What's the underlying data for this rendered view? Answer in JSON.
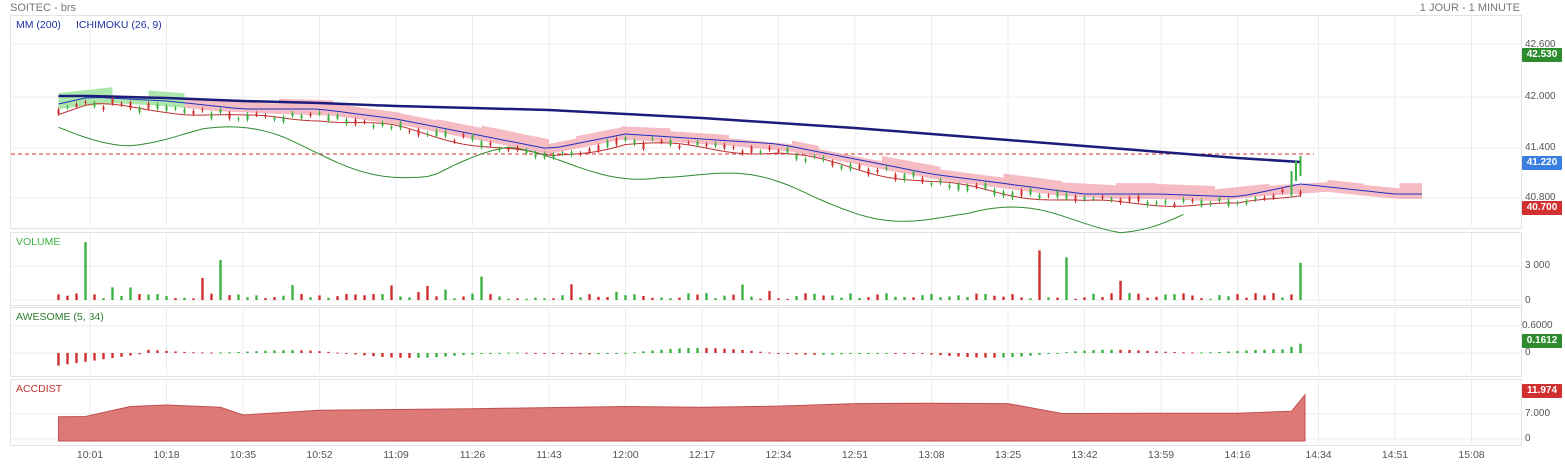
{
  "header": {
    "title": "SOITEC - brs",
    "period": "1 JOUR - 1 MINUTE"
  },
  "main_panel": {
    "legend_ma": "MM (200)",
    "legend_ichimoku": "ICHIMOKU (26, 9)",
    "y_ticks": [
      "42.600",
      "42.000",
      "41.400",
      "40.800"
    ],
    "tags": [
      {
        "text": "42.530",
        "color": "#2e8b2e"
      },
      {
        "text": "41.220",
        "color": "#3a7fe0"
      },
      {
        "text": "40.700",
        "color": "#d03030"
      }
    ]
  },
  "volume_panel": {
    "label": "VOLUME",
    "y_ticks": [
      "3 000",
      "0"
    ]
  },
  "awesome_panel": {
    "label": "AWESOME (5, 34)",
    "y_ticks": [
      "0.6000",
      "0"
    ],
    "tag": {
      "text": "0.1612",
      "color": "#2e8b2e"
    }
  },
  "accdist_panel": {
    "label": "ACCDIST",
    "y_ticks": [
      "7.000",
      "0"
    ],
    "tag": {
      "text": "11.974",
      "color": "#d03030"
    }
  },
  "x_labels": [
    "10:01",
    "10:18",
    "10:35",
    "10:52",
    "11:09",
    "11:26",
    "11:43",
    "12:00",
    "12:17",
    "12:34",
    "12:51",
    "13:08",
    "13:25",
    "13:42",
    "13:59",
    "14:16",
    "14:34",
    "14:51",
    "15:08"
  ],
  "colors": {
    "up": "#3cb043",
    "down": "#d03030",
    "ma": "#1c1c7a",
    "tenkan": "#c03030",
    "kijun": "#2030c0",
    "chikou": "#2e8b2e",
    "cloud_up": "#9fe39f",
    "cloud_down": "#f4b0b8",
    "accdist_fill": "#dd7a78"
  },
  "chart_data": [
    {
      "type": "line",
      "title": "SOITEC - brs",
      "subtitle": "1 JOUR - 1 MINUTE",
      "ylim": [
        40.6,
        42.7
      ],
      "x": [
        "09:54",
        "10:01",
        "10:18",
        "10:35",
        "10:52",
        "11:09",
        "11:26",
        "11:43",
        "12:00",
        "12:17",
        "12:34",
        "12:51",
        "13:08",
        "13:25",
        "13:42",
        "13:59",
        "14:16",
        "14:30",
        "14:51"
      ],
      "series": [
        {
          "name": "MM (200)",
          "values": [
            41.9,
            41.9,
            41.88,
            41.85,
            41.83,
            41.8,
            41.78,
            41.76,
            41.72,
            41.68,
            41.63,
            41.58,
            41.52,
            41.46,
            41.4,
            41.34,
            41.28,
            41.24,
            null
          ]
        },
        {
          "name": "ICHIMOKU (26, 9)",
          "values": [
            41.75,
            41.82,
            41.78,
            41.7,
            41.7,
            41.6,
            41.45,
            41.3,
            41.45,
            41.4,
            41.35,
            41.2,
            41.05,
            40.95,
            40.85,
            40.85,
            40.82,
            40.95,
            40.85
          ]
        }
      ],
      "last_price": 41.22,
      "high_tag": 42.53,
      "low_tag": 40.7,
      "reference_line": 41.32
    },
    {
      "type": "bar",
      "title": "VOLUME",
      "ylim": [
        0,
        4500
      ],
      "note_seed": 7,
      "spikes": [
        {
          "x": "10:00",
          "value": 4200,
          "dir": "up"
        },
        {
          "x": "10:27",
          "value": 1600,
          "dir": "down"
        },
        {
          "x": "10:30",
          "value": 2900,
          "dir": "up"
        },
        {
          "x": "11:29",
          "value": 1700,
          "dir": "up"
        },
        {
          "x": "13:32",
          "value": 3600,
          "dir": "down"
        },
        {
          "x": "13:39",
          "value": 3100,
          "dir": "up"
        },
        {
          "x": "13:51",
          "value": 1400,
          "dir": "down"
        },
        {
          "x": "14:30",
          "value": 2700,
          "dir": "up"
        }
      ]
    },
    {
      "type": "bar",
      "title": "AWESOME (5, 34)",
      "ylim": [
        -0.3,
        0.7
      ],
      "last_value": 0.1612
    },
    {
      "type": "area",
      "title": "ACCDIST",
      "ylim": [
        -1,
        13
      ],
      "x": [
        "09:54",
        "10:00",
        "10:10",
        "10:18",
        "10:30",
        "10:35",
        "10:52",
        "11:09",
        "11:26",
        "11:43",
        "12:00",
        "12:17",
        "12:34",
        "12:51",
        "13:08",
        "13:25",
        "13:37",
        "13:42",
        "13:59",
        "14:16",
        "14:28",
        "14:31"
      ],
      "values": [
        6.0,
        6.1,
        8.8,
        9.2,
        8.6,
        6.5,
        7.8,
        8.0,
        8.2,
        8.5,
        8.8,
        8.6,
        8.9,
        9.6,
        9.7,
        9.6,
        6.9,
        6.9,
        7.0,
        7.0,
        7.5,
        11.974
      ]
    }
  ]
}
